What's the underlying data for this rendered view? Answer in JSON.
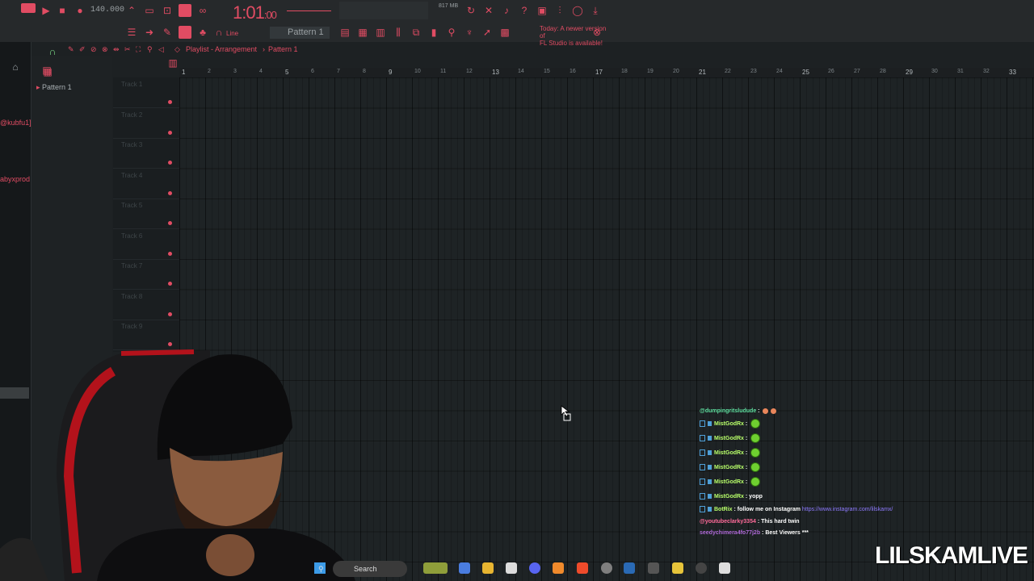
{
  "toolbar": {
    "tempo": "140.000",
    "song_time": "1:01",
    "song_time_suffix": ":00",
    "memory": "817 MB",
    "pattern": "Pattern 1",
    "snap": "Line",
    "news_line1": "Today: A newer version of",
    "news_line2": "FL Studio is available!"
  },
  "playlist": {
    "breadcrumb": "Playlist - Arrangement",
    "breadcrumb_sep": "›",
    "pattern": "Pattern 1",
    "tracks": [
      "Track 1",
      "Track 2",
      "Track 3",
      "Track 4",
      "Track 5",
      "Track 6",
      "Track 7",
      "Track 8",
      "Track 9"
    ],
    "bars": [
      "1",
      "2",
      "3",
      "4",
      "5",
      "6",
      "7",
      "8",
      "9",
      "10",
      "11",
      "12",
      "13",
      "14",
      "15",
      "16",
      "17",
      "18",
      "19",
      "20",
      "21",
      "22",
      "23",
      "24",
      "25",
      "26",
      "27",
      "28",
      "29",
      "30",
      "31",
      "32",
      "33"
    ]
  },
  "browser": {
    "pattern_item": "Pattern 1"
  },
  "left_strip": {
    "user1": "@kubfu1]",
    "user2": "abyxprod"
  },
  "chat": [
    {
      "user": "@dumpingritsludude",
      "sep": " :",
      "msg": "",
      "user_color": "#5fe0a0",
      "emote": "small"
    },
    {
      "user": "MistGodRx",
      "sep": " :",
      "msg": "",
      "user_color": "#b8ff6a",
      "emote": "green"
    },
    {
      "user": "MistGodRx",
      "sep": " :",
      "msg": "",
      "user_color": "#b8ff6a",
      "emote": "green"
    },
    {
      "user": "MistGodRx",
      "sep": " :",
      "msg": "",
      "user_color": "#b8ff6a",
      "emote": "green"
    },
    {
      "user": "MistGodRx",
      "sep": " :",
      "msg": "",
      "user_color": "#b8ff6a",
      "emote": "green"
    },
    {
      "user": "MistGodRx",
      "sep": " :",
      "msg": "",
      "user_color": "#b8ff6a",
      "emote": "green"
    },
    {
      "user": "MistGodRx",
      "sep": " :",
      "msg": " yopp",
      "user_color": "#b8ff6a",
      "emote": ""
    },
    {
      "user": "BotRix",
      "sep": " :",
      "msg": " follow me on Instagram ",
      "link": "https://www.instagram.com/lilskamx/",
      "user_color": "#b8ff6a",
      "emote": ""
    },
    {
      "user": "@youtubeclarky3354",
      "sep": " :",
      "msg": " This hard twin",
      "user_color": "#ff6b9a",
      "emote": ""
    },
    {
      "user": "seedychimera4fo77j2b",
      "sep": " :",
      "msg": " Best Viewers ***",
      "user_color": "#b06ad8",
      "emote": ""
    }
  ],
  "watermark": "LILSKAMLIVE",
  "taskbar": {
    "search_label": "Search"
  },
  "colors": {
    "accent": "#e14c63",
    "grid_bg": "#1e2325",
    "chat_link": "#8e7bff"
  }
}
